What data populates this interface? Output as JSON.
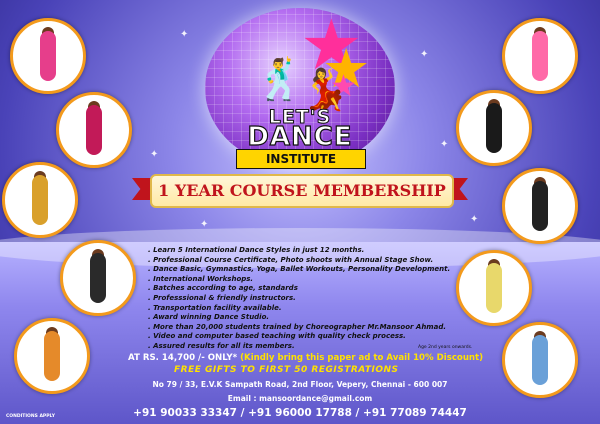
{
  "logo": {
    "line1": "LET'S",
    "line2": "DANCE",
    "line3": "INSTITUTE"
  },
  "banner": "1 YEAR COURSE MEMBERSHIP",
  "features": [
    ". Learn 5 International Dance Styles in just 12 months.",
    ". Professional Course Certificate, Photo shoots with Annual Stage Show.",
    ". Dance Basic, Gymnastics, Yoga, Ballet Workouts, Personality Development.",
    ". International Workshops.",
    ". Batches according to age, standards",
    ". Professsional & friendly instructors.",
    ". Transportation facility available.",
    ". Award winning Dance Studio.",
    ". More than 20,000 students trained by Choreographer Mr.Mansoor Ahmad.",
    ". Video and computer based teaching with quality check process.",
    ". Assured results for all its members."
  ],
  "age_note": "Age 2nd years onwards.",
  "price": "AT RS. 14,700 /- ONLY*",
  "discount": "(Kindly bring this paper ad to Avail 10% Discount)",
  "gifts": "FREE GIFTS TO FIRST 50 REGISTRATIONS",
  "address": "No 79 / 33, E.V.K Sampath Road, 2nd Floor, Vepery, Chennai - 600 007",
  "email": "Email : mansoordance@gmail.com",
  "phones": "+91 90033 33347 / +91 96000 17788 / +91 77089 74447",
  "conditions": "CONDITIONS APPLY",
  "colors": {
    "accent_orange": "#f39a1c",
    "banner_red": "#c0141c",
    "highlight_yellow": "#ffe100",
    "ball_purple": "#7a2fc2"
  }
}
